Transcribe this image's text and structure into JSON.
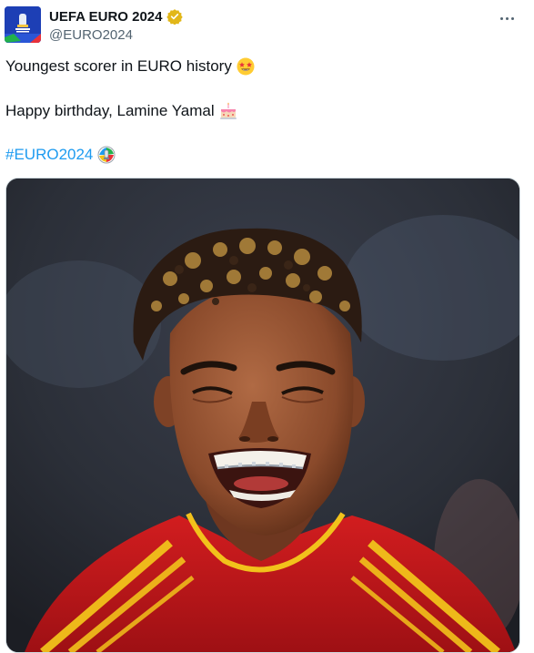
{
  "author": {
    "display_name": "UEFA EURO 2024",
    "handle": "@EURO2024",
    "verified": true,
    "avatar_icon": "euro2024-logo-icon",
    "verified_icon": "verified-badge-icon"
  },
  "menu": {
    "icon": "more-options-icon"
  },
  "body": {
    "line1": "Youngest scorer in EURO history",
    "line1_emoji": "star-struck-emoji",
    "line2": "Happy birthday, Lamine Yamal",
    "line2_emoji": "birthday-cake-emoji",
    "hashtag": "#EURO2024",
    "hashtag_emoji": "euro2024-trophy-emoji"
  },
  "colors": {
    "link": "#1d9bf0",
    "text": "#0f1419",
    "secondary": "#536471",
    "verified": "#e2b719",
    "jersey": "#c8171c",
    "jersey_stripes": "#f2c21b"
  },
  "media": {
    "type": "photo",
    "subject": "smiling-player-photo"
  }
}
